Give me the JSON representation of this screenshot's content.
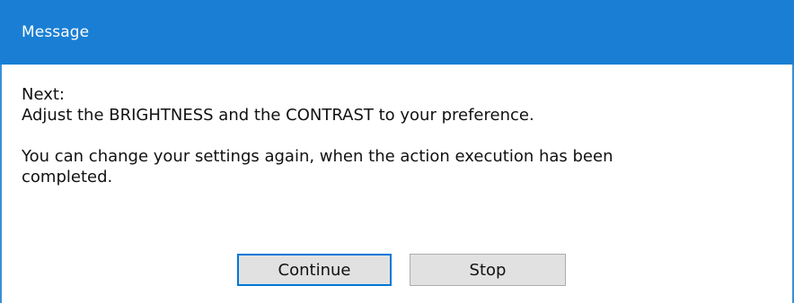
{
  "window": {
    "title": "Message"
  },
  "message": {
    "lines": [
      "Next:",
      "Adjust the BRIGHTNESS and the CONTRAST to your preference.",
      "",
      "You can change your settings again, when the action execution has been",
      "completed."
    ]
  },
  "buttons": {
    "continue_label": "Continue",
    "stop_label": "Stop"
  },
  "colors": {
    "titlebar": "#1a7fd4",
    "focus_border": "#0078d7",
    "button_face": "#e1e1e1"
  }
}
